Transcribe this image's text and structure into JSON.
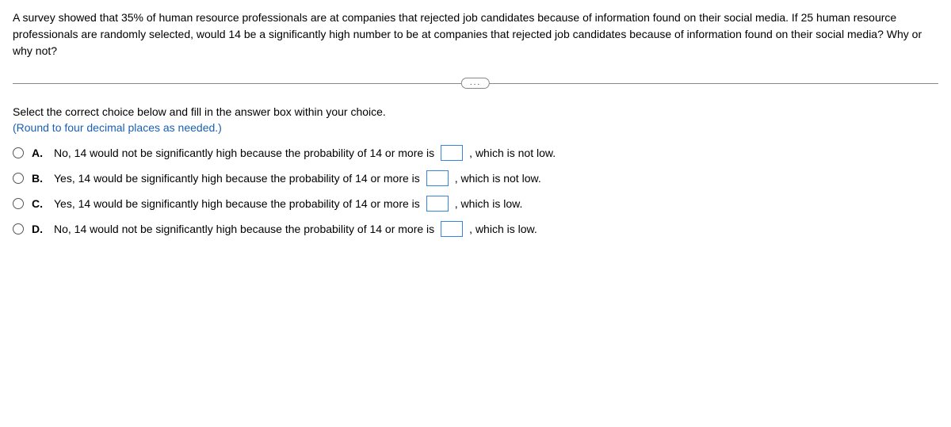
{
  "question": "A survey showed that 35% of human resource professionals are at companies that rejected job candidates because of information found on their social media. If 25 human resource professionals are randomly selected, would 14 be a significantly high number to be at companies that rejected job candidates because of information found on their social media? Why or why not?",
  "divider": {
    "ellipsis": "..."
  },
  "instruction": "Select the correct choice below and fill in the answer box within your choice.",
  "rounding_note": "(Round to four decimal places as needed.)",
  "choices": [
    {
      "letter": "A.",
      "pre": "No, 14 would not be significantly high because the probability of 14 or more is",
      "post": ", which is not low."
    },
    {
      "letter": "B.",
      "pre": "Yes, 14 would be significantly high because the probability of 14 or more is",
      "post": ", which is not low."
    },
    {
      "letter": "C.",
      "pre": "Yes, 14 would be significantly high because the probability of 14 or more is",
      "post": ", which is low."
    },
    {
      "letter": "D.",
      "pre": "No, 14 would not be significantly high because the probability of 14 or more is",
      "post": ", which is low."
    }
  ]
}
